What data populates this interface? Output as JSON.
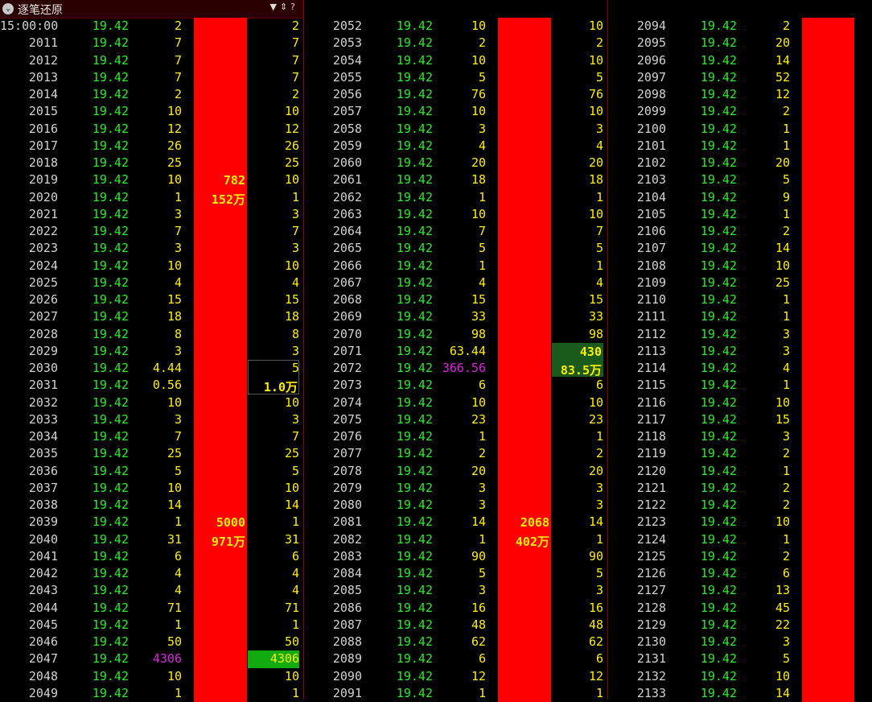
{
  "window": {
    "title": "逐笔还原",
    "tools": [
      "filter-icon",
      "sort-icon",
      "help-icon"
    ],
    "tool_glyphs": [
      "▼",
      "⇕",
      "?"
    ]
  },
  "columns": [
    {
      "rows": [
        {
          "time": "15:00:00",
          "price": "19.42",
          "vol": "2",
          "rvol": "2"
        },
        {
          "time": "2011",
          "price": "19.42",
          "vol": "7",
          "rvol": "7"
        },
        {
          "time": "2012",
          "price": "19.42",
          "vol": "7",
          "rvol": "7"
        },
        {
          "time": "2013",
          "price": "19.42",
          "vol": "7",
          "rvol": "7"
        },
        {
          "time": "2014",
          "price": "19.42",
          "vol": "2",
          "rvol": "2"
        },
        {
          "time": "2015",
          "price": "19.42",
          "vol": "10",
          "rvol": "10"
        },
        {
          "time": "2016",
          "price": "19.42",
          "vol": "12",
          "rvol": "12"
        },
        {
          "time": "2017",
          "price": "19.42",
          "vol": "26",
          "rvol": "26"
        },
        {
          "time": "2018",
          "price": "19.42",
          "vol": "25",
          "rvol": "25"
        },
        {
          "time": "2019",
          "price": "19.42",
          "vol": "10",
          "rvol": "10"
        },
        {
          "time": "2020",
          "price": "19.42",
          "vol": "1",
          "rvol": "1"
        },
        {
          "time": "2021",
          "price": "19.42",
          "vol": "3",
          "rvol": "3"
        },
        {
          "time": "2022",
          "price": "19.42",
          "vol": "7",
          "rvol": "7"
        },
        {
          "time": "2023",
          "price": "19.42",
          "vol": "3",
          "rvol": "3"
        },
        {
          "time": "2024",
          "price": "19.42",
          "vol": "10",
          "rvol": "10"
        },
        {
          "time": "2025",
          "price": "19.42",
          "vol": "4",
          "rvol": "4"
        },
        {
          "time": "2026",
          "price": "19.42",
          "vol": "15",
          "rvol": "15"
        },
        {
          "time": "2027",
          "price": "19.42",
          "vol": "18",
          "rvol": "18"
        },
        {
          "time": "2028",
          "price": "19.42",
          "vol": "8",
          "rvol": "8"
        },
        {
          "time": "2029",
          "price": "19.42",
          "vol": "3",
          "rvol": "3"
        },
        {
          "time": "2030",
          "price": "19.42",
          "vol": "4.44",
          "rvol": "5"
        },
        {
          "time": "2031",
          "price": "19.42",
          "vol": "0.56",
          "rvol": ""
        },
        {
          "time": "2032",
          "price": "19.42",
          "vol": "10",
          "rvol": "10"
        },
        {
          "time": "2033",
          "price": "19.42",
          "vol": "3",
          "rvol": "3"
        },
        {
          "time": "2034",
          "price": "19.42",
          "vol": "7",
          "rvol": "7"
        },
        {
          "time": "2035",
          "price": "19.42",
          "vol": "25",
          "rvol": "25"
        },
        {
          "time": "2036",
          "price": "19.42",
          "vol": "5",
          "rvol": "5"
        },
        {
          "time": "2037",
          "price": "19.42",
          "vol": "10",
          "rvol": "10"
        },
        {
          "time": "2038",
          "price": "19.42",
          "vol": "14",
          "rvol": "14"
        },
        {
          "time": "2039",
          "price": "19.42",
          "vol": "1",
          "rvol": "1"
        },
        {
          "time": "2040",
          "price": "19.42",
          "vol": "31",
          "rvol": "31"
        },
        {
          "time": "2041",
          "price": "19.42",
          "vol": "6",
          "rvol": "6"
        },
        {
          "time": "2042",
          "price": "19.42",
          "vol": "4",
          "rvol": "4"
        },
        {
          "time": "2043",
          "price": "19.42",
          "vol": "4",
          "rvol": "4"
        },
        {
          "time": "2044",
          "price": "19.42",
          "vol": "71",
          "rvol": "71"
        },
        {
          "time": "2045",
          "price": "19.42",
          "vol": "1",
          "rvol": "1"
        },
        {
          "time": "2046",
          "price": "19.42",
          "vol": "50",
          "rvol": "50"
        },
        {
          "time": "2047",
          "price": "19.42",
          "vol": "4306",
          "rvol": "4306",
          "big": true
        },
        {
          "time": "2048",
          "price": "19.42",
          "vol": "10",
          "rvol": "10"
        },
        {
          "time": "2049",
          "price": "19.42",
          "vol": "1",
          "rvol": "1"
        }
      ],
      "blocks": [
        {
          "from": 0,
          "to": 20,
          "kind": "red",
          "side": "mid",
          "l1": "782",
          "l2": "152万"
        },
        {
          "from": 20,
          "to": 40,
          "kind": "red",
          "side": "mid",
          "l1": "5000",
          "l2": "971万"
        },
        {
          "from": 20,
          "to": 22,
          "kind": "outline",
          "side": "right",
          "l1": "",
          "l2": "1.0万"
        },
        {
          "from": 37,
          "to": 38,
          "kind": "brightgreen",
          "side": "right",
          "l1": "",
          "l2": ""
        }
      ]
    },
    {
      "rows": [
        {
          "time": "2052",
          "price": "19.42",
          "vol": "10",
          "rvol": "10"
        },
        {
          "time": "2053",
          "price": "19.42",
          "vol": "2",
          "rvol": "2"
        },
        {
          "time": "2054",
          "price": "19.42",
          "vol": "10",
          "rvol": "10"
        },
        {
          "time": "2055",
          "price": "19.42",
          "vol": "5",
          "rvol": "5"
        },
        {
          "time": "2056",
          "price": "19.42",
          "vol": "76",
          "rvol": "76"
        },
        {
          "time": "2057",
          "price": "19.42",
          "vol": "10",
          "rvol": "10"
        },
        {
          "time": "2058",
          "price": "19.42",
          "vol": "3",
          "rvol": "3"
        },
        {
          "time": "2059",
          "price": "19.42",
          "vol": "4",
          "rvol": "4"
        },
        {
          "time": "2060",
          "price": "19.42",
          "vol": "20",
          "rvol": "20"
        },
        {
          "time": "2061",
          "price": "19.42",
          "vol": "18",
          "rvol": "18"
        },
        {
          "time": "2062",
          "price": "19.42",
          "vol": "1",
          "rvol": "1"
        },
        {
          "time": "2063",
          "price": "19.42",
          "vol": "10",
          "rvol": "10"
        },
        {
          "time": "2064",
          "price": "19.42",
          "vol": "7",
          "rvol": "7"
        },
        {
          "time": "2065",
          "price": "19.42",
          "vol": "5",
          "rvol": "5"
        },
        {
          "time": "2066",
          "price": "19.42",
          "vol": "1",
          "rvol": "1"
        },
        {
          "time": "2067",
          "price": "19.42",
          "vol": "4",
          "rvol": "4"
        },
        {
          "time": "2068",
          "price": "19.42",
          "vol": "15",
          "rvol": "15"
        },
        {
          "time": "2069",
          "price": "19.42",
          "vol": "33",
          "rvol": "33"
        },
        {
          "time": "2070",
          "price": "19.42",
          "vol": "98",
          "rvol": "98"
        },
        {
          "time": "2071",
          "price": "19.42",
          "vol": "63.44",
          "rvol": ""
        },
        {
          "time": "2072",
          "price": "19.42",
          "vol": "366.56",
          "rvol": "",
          "big": true
        },
        {
          "time": "2073",
          "price": "19.42",
          "vol": "6",
          "rvol": "6"
        },
        {
          "time": "2074",
          "price": "19.42",
          "vol": "10",
          "rvol": "10"
        },
        {
          "time": "2075",
          "price": "19.42",
          "vol": "23",
          "rvol": "23"
        },
        {
          "time": "2076",
          "price": "19.42",
          "vol": "1",
          "rvol": "1"
        },
        {
          "time": "2077",
          "price": "19.42",
          "vol": "2",
          "rvol": "2"
        },
        {
          "time": "2078",
          "price": "19.42",
          "vol": "20",
          "rvol": "20"
        },
        {
          "time": "2079",
          "price": "19.42",
          "vol": "3",
          "rvol": "3"
        },
        {
          "time": "2080",
          "price": "19.42",
          "vol": "3",
          "rvol": "3"
        },
        {
          "time": "2081",
          "price": "19.42",
          "vol": "14",
          "rvol": "14"
        },
        {
          "time": "2082",
          "price": "19.42",
          "vol": "1",
          "rvol": "1"
        },
        {
          "time": "2083",
          "price": "19.42",
          "vol": "90",
          "rvol": "90"
        },
        {
          "time": "2084",
          "price": "19.42",
          "vol": "5",
          "rvol": "5"
        },
        {
          "time": "2085",
          "price": "19.42",
          "vol": "3",
          "rvol": "3"
        },
        {
          "time": "2086",
          "price": "19.42",
          "vol": "16",
          "rvol": "16"
        },
        {
          "time": "2087",
          "price": "19.42",
          "vol": "48",
          "rvol": "48"
        },
        {
          "time": "2088",
          "price": "19.42",
          "vol": "62",
          "rvol": "62"
        },
        {
          "time": "2089",
          "price": "19.42",
          "vol": "6",
          "rvol": "6"
        },
        {
          "time": "2090",
          "price": "19.42",
          "vol": "12",
          "rvol": "12"
        },
        {
          "time": "2091",
          "price": "19.42",
          "vol": "1",
          "rvol": "1"
        }
      ],
      "blocks": [
        {
          "from": 0,
          "to": 20,
          "kind": "red",
          "side": "mid",
          "l1": "",
          "l2": ""
        },
        {
          "from": 20,
          "to": 40,
          "kind": "red",
          "side": "mid",
          "l1": "2068",
          "l2": "402万"
        },
        {
          "from": 19,
          "to": 21,
          "kind": "green",
          "side": "right",
          "l1": "430",
          "l2": "83.5万"
        }
      ]
    },
    {
      "rows": [
        {
          "time": "2094",
          "price": "19.42",
          "vol": "2"
        },
        {
          "time": "2095",
          "price": "19.42",
          "vol": "20"
        },
        {
          "time": "2096",
          "price": "19.42",
          "vol": "14"
        },
        {
          "time": "2097",
          "price": "19.42",
          "vol": "52"
        },
        {
          "time": "2098",
          "price": "19.42",
          "vol": "12"
        },
        {
          "time": "2099",
          "price": "19.42",
          "vol": "2"
        },
        {
          "time": "2100",
          "price": "19.42",
          "vol": "1"
        },
        {
          "time": "2101",
          "price": "19.42",
          "vol": "1"
        },
        {
          "time": "2102",
          "price": "19.42",
          "vol": "20"
        },
        {
          "time": "2103",
          "price": "19.42",
          "vol": "5"
        },
        {
          "time": "2104",
          "price": "19.42",
          "vol": "9"
        },
        {
          "time": "2105",
          "price": "19.42",
          "vol": "1"
        },
        {
          "time": "2106",
          "price": "19.42",
          "vol": "2"
        },
        {
          "time": "2107",
          "price": "19.42",
          "vol": "14"
        },
        {
          "time": "2108",
          "price": "19.42",
          "vol": "10"
        },
        {
          "time": "2109",
          "price": "19.42",
          "vol": "25"
        },
        {
          "time": "2110",
          "price": "19.42",
          "vol": "1"
        },
        {
          "time": "2111",
          "price": "19.42",
          "vol": "1"
        },
        {
          "time": "2112",
          "price": "19.42",
          "vol": "3"
        },
        {
          "time": "2113",
          "price": "19.42",
          "vol": "3"
        },
        {
          "time": "2114",
          "price": "19.42",
          "vol": "4"
        },
        {
          "time": "2115",
          "price": "19.42",
          "vol": "1"
        },
        {
          "time": "2116",
          "price": "19.42",
          "vol": "10"
        },
        {
          "time": "2117",
          "price": "19.42",
          "vol": "15"
        },
        {
          "time": "2118",
          "price": "19.42",
          "vol": "3"
        },
        {
          "time": "2119",
          "price": "19.42",
          "vol": "2"
        },
        {
          "time": "2120",
          "price": "19.42",
          "vol": "1"
        },
        {
          "time": "2121",
          "price": "19.42",
          "vol": "2"
        },
        {
          "time": "2122",
          "price": "19.42",
          "vol": "2"
        },
        {
          "time": "2123",
          "price": "19.42",
          "vol": "10"
        },
        {
          "time": "2124",
          "price": "19.42",
          "vol": "1"
        },
        {
          "time": "2125",
          "price": "19.42",
          "vol": "2"
        },
        {
          "time": "2126",
          "price": "19.42",
          "vol": "6"
        },
        {
          "time": "2127",
          "price": "19.42",
          "vol": "13"
        },
        {
          "time": "2128",
          "price": "19.42",
          "vol": "45"
        },
        {
          "time": "2129",
          "price": "19.42",
          "vol": "22"
        },
        {
          "time": "2130",
          "price": "19.42",
          "vol": "3"
        },
        {
          "time": "2131",
          "price": "19.42",
          "vol": "5"
        },
        {
          "time": "2132",
          "price": "19.42",
          "vol": "10"
        },
        {
          "time": "2133",
          "price": "19.42",
          "vol": "14"
        }
      ],
      "blocks": [
        {
          "from": 0,
          "to": 40,
          "kind": "red",
          "side": "mid",
          "l1": "",
          "l2": ""
        }
      ]
    }
  ]
}
